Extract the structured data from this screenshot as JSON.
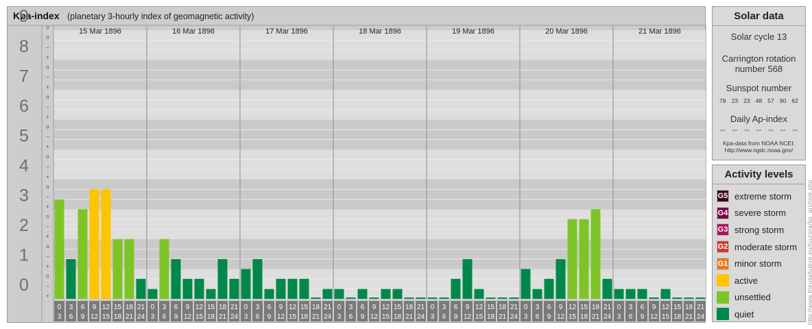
{
  "chart_data": {
    "type": "bar",
    "title": "Kpa-index",
    "subtitle": "(planetary 3-hourly index of geomagnetic activity)",
    "ylim": [
      0,
      9
    ],
    "yticks": [
      "0",
      "1",
      "2",
      "3",
      "4",
      "5",
      "6",
      "7",
      "8",
      "9"
    ],
    "minor_ticks": [
      "+",
      "o",
      "–"
    ],
    "days": [
      "15 Mar 1896",
      "16 Mar 1896",
      "17 Mar 1896",
      "18 Mar 1896",
      "19 Mar 1896",
      "20 Mar 1896",
      "21 Mar 1896"
    ],
    "interval_start": [
      "0",
      "3",
      "6",
      "9",
      "12",
      "15",
      "18",
      "21"
    ],
    "interval_end": [
      "3",
      "6",
      "9",
      "12",
      "15",
      "18",
      "21",
      "24"
    ],
    "values": [
      [
        3.33,
        1.33,
        3.0,
        3.67,
        3.67,
        2.0,
        2.0,
        0.67
      ],
      [
        0.33,
        2.0,
        1.33,
        0.67,
        0.67,
        0.33,
        1.33,
        0.67
      ],
      [
        1.0,
        1.33,
        0.33,
        0.67,
        0.67,
        0.67,
        0.0,
        0.33
      ],
      [
        0.33,
        0.0,
        0.33,
        0.0,
        0.33,
        0.33,
        0.0,
        0.0
      ],
      [
        0.0,
        0.0,
        0.67,
        1.33,
        0.33,
        0.0,
        0.0,
        0.0
      ],
      [
        1.0,
        0.33,
        0.67,
        1.33,
        2.67,
        2.67,
        3.0,
        0.67
      ],
      [
        0.33,
        0.33,
        0.33,
        0.0,
        0.33,
        0.0,
        0.0,
        0.0
      ]
    ],
    "grid": true
  },
  "colors": {
    "quiet": "#00884a",
    "unsettled": "#7ec428",
    "active": "#ffc400",
    "g1": "#e4791d",
    "g2": "#d5372c",
    "g3": "#b0115e",
    "g4": "#7b0a49",
    "g5": "#400018"
  },
  "solar": {
    "heading": "Solar data",
    "cycle": "Solar cycle 13",
    "carrington_line1": "Carrington rotation",
    "carrington_line2": "number 568",
    "sunspot_label": "Sunspot number",
    "sunspot_values": [
      "78",
      "23",
      "23",
      "48",
      "57",
      "90",
      "62"
    ],
    "ap_label": "Daily Ap-index",
    "ap_values": [
      "--",
      "--",
      "--",
      "--",
      "--",
      "--",
      "--"
    ],
    "source_line1": "Kpa-data from NOAA NCEI:",
    "source_line2": "http://www.ngdc.noaa.gov/"
  },
  "activity": {
    "heading": "Activity levels",
    "levels": [
      {
        "code": "G5",
        "label": "extreme storm",
        "color": "#400018"
      },
      {
        "code": "G4",
        "label": "severe storm",
        "color": "#7b0a49"
      },
      {
        "code": "G3",
        "label": "strong storm",
        "color": "#b0115e"
      },
      {
        "code": "G2",
        "label": "moderate storm",
        "color": "#d5372c"
      },
      {
        "code": "G1",
        "label": "minor storm",
        "color": "#e4791d"
      },
      {
        "code": "",
        "label": "active",
        "color": "#ffc400"
      },
      {
        "code": "",
        "label": "unsettled",
        "color": "#7ec428"
      },
      {
        "code": "",
        "label": "quiet",
        "color": "#00884a"
      }
    ]
  },
  "watermark": "http://www.theusefuleye.eu/fuurora/kp_archive.php"
}
